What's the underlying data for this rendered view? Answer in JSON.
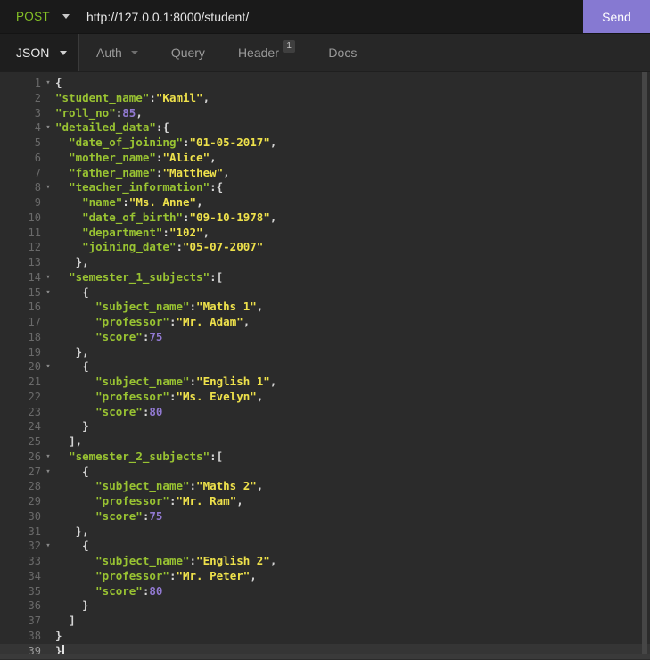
{
  "topbar": {
    "method": "POST",
    "url": "http://127.0.0.1:8000/student/",
    "send_label": "Send"
  },
  "tabs": {
    "body_tab": "JSON",
    "items": [
      {
        "label": "Auth",
        "caret": true
      },
      {
        "label": "Query"
      },
      {
        "label": "Header",
        "badge": "1"
      },
      {
        "label": "Docs"
      }
    ]
  },
  "colors": {
    "method_green": "#85c226",
    "send_purple": "#8679d2",
    "key_green": "#99c332",
    "string_yellow": "#eee14b",
    "number_purple": "#9179d1",
    "punctuation": "#d6d6d6"
  },
  "editor": {
    "active_line": 39,
    "lines": [
      {
        "n": 1,
        "fold": true,
        "ind": 0,
        "tok": [
          [
            "p",
            "{"
          ]
        ]
      },
      {
        "n": 2,
        "ind": 0,
        "tok": [
          [
            "k",
            "\"student_name\""
          ],
          [
            "p",
            ":"
          ],
          [
            "s",
            "\"Kamil\""
          ],
          [
            "p",
            ","
          ]
        ]
      },
      {
        "n": 3,
        "ind": 0,
        "tok": [
          [
            "k",
            "\"roll_no\""
          ],
          [
            "p",
            ":"
          ],
          [
            "n",
            "85"
          ],
          [
            "p",
            ","
          ]
        ]
      },
      {
        "n": 4,
        "fold": true,
        "ind": 0,
        "tok": [
          [
            "k",
            "\"detailed_data\""
          ],
          [
            "p",
            ":{"
          ]
        ]
      },
      {
        "n": 5,
        "ind": 2,
        "tok": [
          [
            "k",
            "\"date_of_joining\""
          ],
          [
            "p",
            ":"
          ],
          [
            "s",
            "\"01-05-2017\""
          ],
          [
            "p",
            ","
          ]
        ]
      },
      {
        "n": 6,
        "ind": 2,
        "tok": [
          [
            "k",
            "\"mother_name\""
          ],
          [
            "p",
            ":"
          ],
          [
            "s",
            "\"Alice\""
          ],
          [
            "p",
            ","
          ]
        ]
      },
      {
        "n": 7,
        "ind": 2,
        "tok": [
          [
            "k",
            "\"father_name\""
          ],
          [
            "p",
            ":"
          ],
          [
            "s",
            "\"Matthew\""
          ],
          [
            "p",
            ","
          ]
        ]
      },
      {
        "n": 8,
        "fold": true,
        "ind": 2,
        "tok": [
          [
            "k",
            "\"teacher_information\""
          ],
          [
            "p",
            ":{"
          ]
        ]
      },
      {
        "n": 9,
        "ind": 4,
        "tok": [
          [
            "k",
            "\"name\""
          ],
          [
            "p",
            ":"
          ],
          [
            "s",
            "\"Ms. Anne\""
          ],
          [
            "p",
            ","
          ]
        ]
      },
      {
        "n": 10,
        "ind": 4,
        "tok": [
          [
            "k",
            "\"date_of_birth\""
          ],
          [
            "p",
            ":"
          ],
          [
            "s",
            "\"09-10-1978\""
          ],
          [
            "p",
            ","
          ]
        ]
      },
      {
        "n": 11,
        "ind": 4,
        "tok": [
          [
            "k",
            "\"department\""
          ],
          [
            "p",
            ":"
          ],
          [
            "s",
            "\"102\""
          ],
          [
            "p",
            ","
          ]
        ]
      },
      {
        "n": 12,
        "ind": 4,
        "tok": [
          [
            "k",
            "\"joining_date\""
          ],
          [
            "p",
            ":"
          ],
          [
            "s",
            "\"05-07-2007\""
          ]
        ]
      },
      {
        "n": 13,
        "ind": 3,
        "tok": [
          [
            "p",
            "},"
          ]
        ]
      },
      {
        "n": 14,
        "fold": true,
        "ind": 2,
        "tok": [
          [
            "k",
            "\"semester_1_subjects\""
          ],
          [
            "p",
            ":["
          ]
        ]
      },
      {
        "n": 15,
        "fold": true,
        "ind": 4,
        "tok": [
          [
            "p",
            "{"
          ]
        ]
      },
      {
        "n": 16,
        "ind": 6,
        "tok": [
          [
            "k",
            "\"subject_name\""
          ],
          [
            "p",
            ":"
          ],
          [
            "s",
            "\"Maths 1\""
          ],
          [
            "p",
            ","
          ]
        ]
      },
      {
        "n": 17,
        "ind": 6,
        "tok": [
          [
            "k",
            "\"professor\""
          ],
          [
            "p",
            ":"
          ],
          [
            "s",
            "\"Mr. Adam\""
          ],
          [
            "p",
            ","
          ]
        ]
      },
      {
        "n": 18,
        "ind": 6,
        "tok": [
          [
            "k",
            "\"score\""
          ],
          [
            "p",
            ":"
          ],
          [
            "n",
            "75"
          ]
        ]
      },
      {
        "n": 19,
        "ind": 3,
        "tok": [
          [
            "p",
            "},"
          ]
        ]
      },
      {
        "n": 20,
        "fold": true,
        "ind": 4,
        "tok": [
          [
            "p",
            "{"
          ]
        ]
      },
      {
        "n": 21,
        "ind": 6,
        "tok": [
          [
            "k",
            "\"subject_name\""
          ],
          [
            "p",
            ":"
          ],
          [
            "s",
            "\"English 1\""
          ],
          [
            "p",
            ","
          ]
        ]
      },
      {
        "n": 22,
        "ind": 6,
        "tok": [
          [
            "k",
            "\"professor\""
          ],
          [
            "p",
            ":"
          ],
          [
            "s",
            "\"Ms. Evelyn\""
          ],
          [
            "p",
            ","
          ]
        ]
      },
      {
        "n": 23,
        "ind": 6,
        "tok": [
          [
            "k",
            "\"score\""
          ],
          [
            "p",
            ":"
          ],
          [
            "n",
            "80"
          ]
        ]
      },
      {
        "n": 24,
        "ind": 4,
        "tok": [
          [
            "p",
            "}"
          ]
        ]
      },
      {
        "n": 25,
        "ind": 2,
        "tok": [
          [
            "p",
            "],"
          ]
        ]
      },
      {
        "n": 26,
        "fold": true,
        "ind": 2,
        "tok": [
          [
            "k",
            "\"semester_2_subjects\""
          ],
          [
            "p",
            ":["
          ]
        ]
      },
      {
        "n": 27,
        "fold": true,
        "ind": 4,
        "tok": [
          [
            "p",
            "{"
          ]
        ]
      },
      {
        "n": 28,
        "ind": 6,
        "tok": [
          [
            "k",
            "\"subject_name\""
          ],
          [
            "p",
            ":"
          ],
          [
            "s",
            "\"Maths 2\""
          ],
          [
            "p",
            ","
          ]
        ]
      },
      {
        "n": 29,
        "ind": 6,
        "tok": [
          [
            "k",
            "\"professor\""
          ],
          [
            "p",
            ":"
          ],
          [
            "s",
            "\"Mr. Ram\""
          ],
          [
            "p",
            ","
          ]
        ]
      },
      {
        "n": 30,
        "ind": 6,
        "tok": [
          [
            "k",
            "\"score\""
          ],
          [
            "p",
            ":"
          ],
          [
            "n",
            "75"
          ]
        ]
      },
      {
        "n": 31,
        "ind": 3,
        "tok": [
          [
            "p",
            "},"
          ]
        ]
      },
      {
        "n": 32,
        "fold": true,
        "ind": 4,
        "tok": [
          [
            "p",
            "{"
          ]
        ]
      },
      {
        "n": 33,
        "ind": 6,
        "tok": [
          [
            "k",
            "\"subject_name\""
          ],
          [
            "p",
            ":"
          ],
          [
            "s",
            "\"English 2\""
          ],
          [
            "p",
            ","
          ]
        ]
      },
      {
        "n": 34,
        "ind": 6,
        "tok": [
          [
            "k",
            "\"professor\""
          ],
          [
            "p",
            ":"
          ],
          [
            "s",
            "\"Mr. Peter\""
          ],
          [
            "p",
            ","
          ]
        ]
      },
      {
        "n": 35,
        "ind": 6,
        "tok": [
          [
            "k",
            "\"score\""
          ],
          [
            "p",
            ":"
          ],
          [
            "n",
            "80"
          ]
        ]
      },
      {
        "n": 36,
        "ind": 4,
        "tok": [
          [
            "p",
            "}"
          ]
        ]
      },
      {
        "n": 37,
        "ind": 2,
        "tok": [
          [
            "p",
            "]"
          ]
        ]
      },
      {
        "n": 38,
        "ind": 0,
        "tok": [
          [
            "p",
            "}"
          ]
        ]
      },
      {
        "n": 39,
        "ind": 0,
        "cursor": true,
        "tok": [
          [
            "p",
            "}"
          ]
        ]
      }
    ]
  }
}
